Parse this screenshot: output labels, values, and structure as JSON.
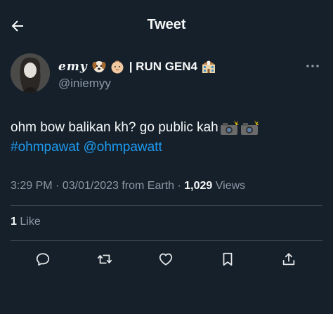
{
  "header": {
    "title": "Tweet"
  },
  "author": {
    "name_part1": "emy",
    "name_part2": "| RUN GEN4",
    "handle": "@iniemyy",
    "emoji_icons": [
      "dog-face-icon",
      "baby-face-icon",
      "school-icon"
    ]
  },
  "tweet": {
    "text": "ohm bow balikan kh? go public kah",
    "text_emojis": [
      "camera-flash-icon",
      "camera-flash-icon"
    ],
    "hashtag": "#ohmpawat",
    "mention": "@ohmpawatt"
  },
  "meta": {
    "time": "3:29 PM",
    "date": "03/01/2023",
    "source": "from Earth",
    "views_count": "1,029",
    "views_label": "Views"
  },
  "likes": {
    "count": "1",
    "label": "Like"
  },
  "actions": [
    "reply-icon",
    "retweet-icon",
    "like-icon",
    "bookmark-icon",
    "share-icon"
  ],
  "colors": {
    "background": "#15202b",
    "text": "#f7f9f9",
    "secondary": "#8b98a5",
    "link": "#1d9bf0",
    "divider": "#38444d"
  }
}
